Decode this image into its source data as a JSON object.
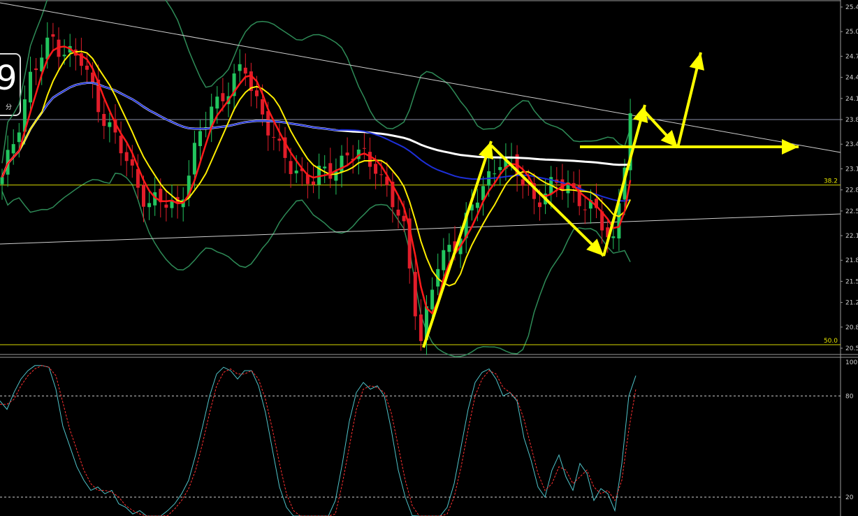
{
  "badge": {
    "number": "9",
    "unit": "分"
  },
  "chart_data": [
    {
      "type": "candlestick",
      "title": "",
      "ylim": [
        20.8,
        25.5
      ],
      "price_ticks": [
        "25.4",
        "25.0",
        "24.7",
        "24.4",
        "24.1",
        "23.8",
        "23.4",
        "23.1",
        "22.8",
        "22.5",
        "22.1",
        "21.8",
        "21.5",
        "21.2",
        "20.8",
        "20.5"
      ],
      "tick_values": [
        25.4,
        25.05,
        24.7,
        24.4,
        24.1,
        23.8,
        23.45,
        23.1,
        22.8,
        22.5,
        22.15,
        21.8,
        21.5,
        21.2,
        20.85,
        20.55
      ],
      "current_price": 23.8,
      "fib_levels": [
        {
          "label": "38.2",
          "value": 22.87
        },
        {
          "label": "50.0",
          "value": 20.6
        }
      ],
      "n_bars": 112,
      "key_points": [
        {
          "i": 0,
          "close": 22.9
        },
        {
          "i": 5,
          "close": 24.4
        },
        {
          "i": 9,
          "close": 24.95
        },
        {
          "i": 14,
          "close": 24.6
        },
        {
          "i": 20,
          "close": 23.5
        },
        {
          "i": 26,
          "close": 22.6
        },
        {
          "i": 31,
          "close": 22.6
        },
        {
          "i": 37,
          "close": 24.0
        },
        {
          "i": 43,
          "close": 24.5
        },
        {
          "i": 49,
          "close": 23.3
        },
        {
          "i": 55,
          "close": 22.9
        },
        {
          "i": 61,
          "close": 23.3
        },
        {
          "i": 66,
          "close": 23.2
        },
        {
          "i": 71,
          "close": 22.2
        },
        {
          "i": 74,
          "close": 20.7
        },
        {
          "i": 77,
          "close": 21.7
        },
        {
          "i": 83,
          "close": 22.5
        },
        {
          "i": 88,
          "close": 23.3
        },
        {
          "i": 94,
          "close": 22.7
        },
        {
          "i": 100,
          "close": 22.9
        },
        {
          "i": 105,
          "close": 22.4
        },
        {
          "i": 108,
          "close": 22.1
        },
        {
          "i": 111,
          "close": 23.8
        }
      ],
      "overlays": [
        "red moving average",
        "yellow moving average",
        "blue moving average",
        "white moving average",
        "green bollinger bands",
        "white trendlines"
      ],
      "annotations": "yellow arrows: up from 20.6 to 23.45, down to 22.0, up to 24.0, down to 23.1, up to 24.75; horizontal arrow at 23.1"
    },
    {
      "type": "line",
      "title": "",
      "ylim": [
        0,
        100
      ],
      "tick_labels": [
        "100",
        "80",
        "20"
      ],
      "levels": [
        80,
        20
      ],
      "series": [
        {
          "color": "#4fc3c9",
          "values": [
            77,
            72,
            82,
            90,
            95,
            98,
            98,
            97,
            84,
            62,
            50,
            38,
            30,
            24,
            26,
            22,
            24,
            16,
            14,
            10,
            12,
            6,
            4,
            8,
            12,
            16,
            22,
            30,
            45,
            62,
            80,
            93,
            97,
            95,
            90,
            95,
            95,
            86,
            70,
            48,
            26,
            14,
            8,
            6,
            8,
            5,
            4,
            6,
            18,
            40,
            65,
            82,
            88,
            84,
            86,
            80,
            60,
            36,
            20,
            9,
            5,
            3,
            4,
            8,
            14,
            28,
            50,
            72,
            88,
            94,
            96,
            90,
            80,
            82,
            77,
            55,
            42,
            26,
            20,
            36,
            45,
            32,
            24,
            40,
            34,
            18,
            25,
            22,
            12,
            40,
            80,
            92
          ]
        },
        {
          "color": "#ff3030",
          "values": [
            75,
            75,
            78,
            86,
            92,
            96,
            98,
            97,
            92,
            76,
            60,
            48,
            36,
            28,
            24,
            24,
            23,
            20,
            15,
            12,
            10,
            8,
            5,
            6,
            9,
            13,
            18,
            25,
            36,
            52,
            70,
            86,
            94,
            96,
            93,
            93,
            95,
            90,
            78,
            60,
            40,
            22,
            12,
            8,
            7,
            6,
            5,
            5,
            10,
            28,
            50,
            72,
            84,
            86,
            85,
            82,
            70,
            50,
            30,
            15,
            8,
            4,
            3,
            6,
            10,
            20,
            38,
            60,
            80,
            90,
            95,
            93,
            85,
            82,
            78,
            66,
            50,
            34,
            24,
            28,
            38,
            36,
            28,
            32,
            36,
            26,
            22,
            24,
            18,
            30,
            60,
            84
          ]
        }
      ]
    }
  ]
}
